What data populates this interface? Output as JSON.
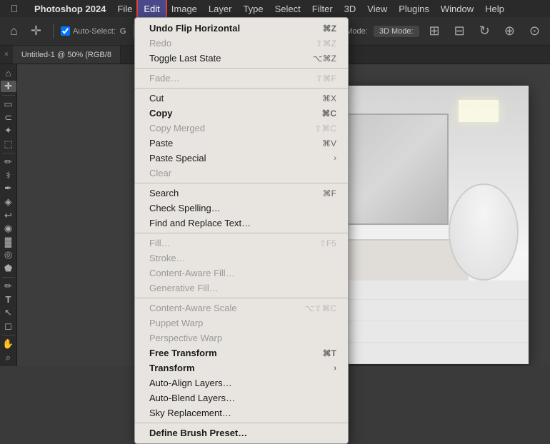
{
  "app": {
    "name": "Photoshop 2024",
    "apple_icon": ""
  },
  "menubar": {
    "items": [
      {
        "label": "File",
        "id": "file"
      },
      {
        "label": "Edit",
        "id": "edit",
        "active": true
      },
      {
        "label": "Image",
        "id": "image"
      },
      {
        "label": "Layer",
        "id": "layer"
      },
      {
        "label": "Type",
        "id": "type"
      },
      {
        "label": "Select",
        "id": "select"
      },
      {
        "label": "Filter",
        "id": "filter"
      },
      {
        "label": "3D",
        "id": "3d"
      },
      {
        "label": "View",
        "id": "view"
      },
      {
        "label": "Plugins",
        "id": "plugins"
      },
      {
        "label": "Window",
        "id": "window"
      },
      {
        "label": "Help",
        "id": "help"
      }
    ]
  },
  "toolbar": {
    "auto_select_label": "Auto-Select:",
    "mode_3d": "3D Mode:",
    "group_label": "G"
  },
  "tab": {
    "title": "Untitled-1 @ 50% (RGB/8"
  },
  "edit_menu": {
    "items": [
      {
        "id": "undo-flip",
        "label": "Undo Flip Horizontal",
        "shortcut": "⌘Z",
        "enabled": true
      },
      {
        "id": "redo",
        "label": "Redo",
        "shortcut": "⇧⌘Z",
        "enabled": false
      },
      {
        "id": "toggle-last",
        "label": "Toggle Last State",
        "shortcut": "⌥⌘Z",
        "enabled": true
      },
      {
        "separator": true
      },
      {
        "id": "fade",
        "label": "Fade…",
        "shortcut": "⇧⌘F",
        "enabled": false
      },
      {
        "separator": true
      },
      {
        "id": "cut",
        "label": "Cut",
        "shortcut": "⌘X",
        "enabled": true
      },
      {
        "id": "copy",
        "label": "Copy",
        "shortcut": "⌘C",
        "enabled": true,
        "bold": true
      },
      {
        "id": "copy-merged",
        "label": "Copy Merged",
        "shortcut": "⇧⌘C",
        "enabled": false
      },
      {
        "id": "paste",
        "label": "Paste",
        "shortcut": "⌘V",
        "enabled": true
      },
      {
        "id": "paste-special",
        "label": "Paste Special",
        "shortcut": "",
        "enabled": true,
        "arrow": true
      },
      {
        "id": "clear",
        "label": "Clear",
        "shortcut": "",
        "enabled": false
      },
      {
        "separator": true
      },
      {
        "id": "search",
        "label": "Search",
        "shortcut": "⌘F",
        "enabled": true
      },
      {
        "id": "check-spelling",
        "label": "Check Spelling…",
        "shortcut": "",
        "enabled": true
      },
      {
        "id": "find-replace",
        "label": "Find and Replace Text…",
        "shortcut": "",
        "enabled": true
      },
      {
        "separator": true
      },
      {
        "id": "fill",
        "label": "Fill…",
        "shortcut": "⇧F5",
        "enabled": false
      },
      {
        "id": "stroke",
        "label": "Stroke…",
        "shortcut": "",
        "enabled": false
      },
      {
        "id": "content-aware-fill",
        "label": "Content-Aware Fill…",
        "shortcut": "",
        "enabled": false
      },
      {
        "id": "generative-fill",
        "label": "Generative Fill…",
        "shortcut": "",
        "enabled": false
      },
      {
        "separator": true
      },
      {
        "id": "content-aware-scale",
        "label": "Content-Aware Scale",
        "shortcut": "⌥⇧⌘C",
        "enabled": false
      },
      {
        "id": "puppet-warp",
        "label": "Puppet Warp",
        "shortcut": "",
        "enabled": false
      },
      {
        "id": "perspective-warp",
        "label": "Perspective Warp",
        "shortcut": "",
        "enabled": false
      },
      {
        "id": "free-transform",
        "label": "Free Transform",
        "shortcut": "⌘T",
        "enabled": true,
        "bold": true
      },
      {
        "id": "transform",
        "label": "Transform",
        "shortcut": "",
        "enabled": true,
        "bold": true,
        "arrow": true
      },
      {
        "id": "auto-align",
        "label": "Auto-Align Layers…",
        "shortcut": "",
        "enabled": true
      },
      {
        "id": "auto-blend",
        "label": "Auto-Blend Layers…",
        "shortcut": "",
        "enabled": true
      },
      {
        "id": "sky-replacement",
        "label": "Sky Replacement…",
        "shortcut": "",
        "enabled": true
      },
      {
        "separator": true
      },
      {
        "id": "define-brush",
        "label": "Define Brush Preset…",
        "shortcut": "",
        "enabled": true,
        "bold": true
      }
    ]
  },
  "tools": [
    {
      "icon": "⌂",
      "name": "home-tool"
    },
    {
      "icon": "✛",
      "name": "move-tool"
    },
    {
      "separator": true
    },
    {
      "icon": "▣",
      "name": "marquee-tool"
    },
    {
      "icon": "⋯",
      "name": "lasso-tool"
    },
    {
      "icon": "✦",
      "name": "quick-select-tool"
    },
    {
      "icon": "⬚",
      "name": "crop-tool"
    },
    {
      "separator": true
    },
    {
      "icon": "✏",
      "name": "eyedropper-tool"
    },
    {
      "icon": "⚕",
      "name": "heal-tool"
    },
    {
      "icon": "✒",
      "name": "brush-tool"
    },
    {
      "icon": "◈",
      "name": "stamp-tool"
    },
    {
      "icon": "↩",
      "name": "history-tool"
    },
    {
      "icon": "◉",
      "name": "eraser-tool"
    },
    {
      "icon": "▓",
      "name": "gradient-tool"
    },
    {
      "icon": "◎",
      "name": "blur-tool"
    },
    {
      "icon": "⬟",
      "name": "dodge-tool"
    },
    {
      "separator": true
    },
    {
      "icon": "✏",
      "name": "pen-tool"
    },
    {
      "icon": "T",
      "name": "text-tool"
    },
    {
      "icon": "↖",
      "name": "path-select-tool"
    },
    {
      "icon": "◻",
      "name": "shape-tool"
    },
    {
      "separator": true
    },
    {
      "icon": "✋",
      "name": "hand-tool"
    },
    {
      "icon": "🔍",
      "name": "zoom-tool"
    }
  ],
  "colors": {
    "menu_bg": "#e8e5e0",
    "menu_border": "#999999",
    "active_item": "#5b68c9",
    "edit_highlight": "#e04040",
    "toolbar_bg": "#2f2f2f",
    "menubar_bg": "#2a2a2a",
    "sidebar_bg": "#2a2a2a",
    "canvas_bg": "#3d3d3d"
  }
}
